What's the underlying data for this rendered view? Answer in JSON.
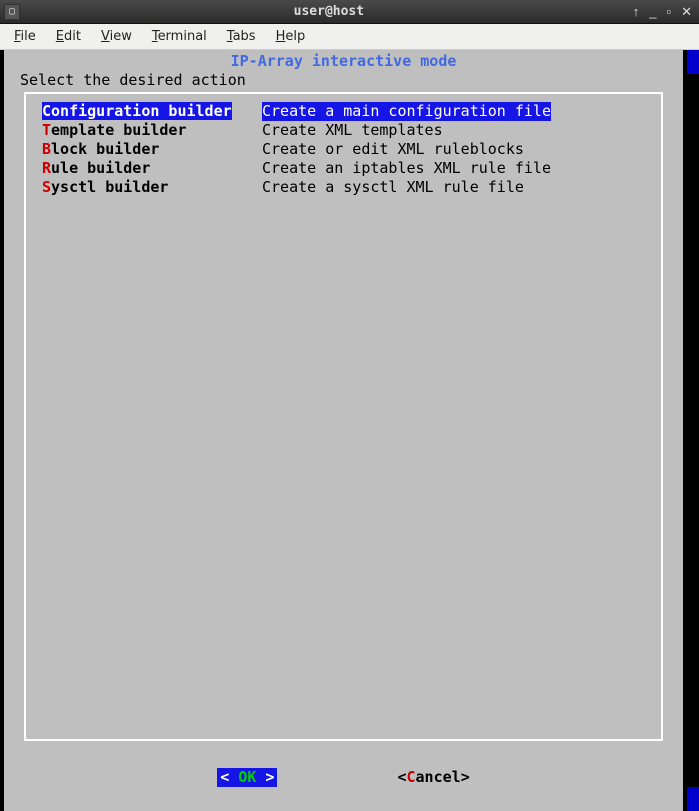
{
  "window": {
    "title": "user@host"
  },
  "menubar": [
    "File",
    "Edit",
    "View",
    "Terminal",
    "Tabs",
    "Help"
  ],
  "dialog": {
    "header": "IP-Array interactive mode",
    "prompt": "Select the desired action",
    "items": [
      {
        "hotkey": "C",
        "rest": "onfiguration builder",
        "desc": "Create a main configuration file",
        "selected": true
      },
      {
        "hotkey": "T",
        "rest": "emplate builder",
        "desc": "Create XML templates",
        "selected": false
      },
      {
        "hotkey": "B",
        "rest": "lock builder",
        "desc": "Create or edit XML ruleblocks",
        "selected": false
      },
      {
        "hotkey": "R",
        "rest": "ule builder",
        "desc": "Create an iptables XML rule file",
        "selected": false
      },
      {
        "hotkey": "S",
        "rest": "ysctl builder",
        "desc": "Create a sysctl XML rule file",
        "selected": false
      }
    ],
    "buttons": {
      "ok_open": "<  ",
      "ok_label": "OK",
      "ok_close": "  >",
      "cancel_open": "<",
      "cancel_hot": "C",
      "cancel_rest": "ancel",
      "cancel_close": ">"
    }
  }
}
